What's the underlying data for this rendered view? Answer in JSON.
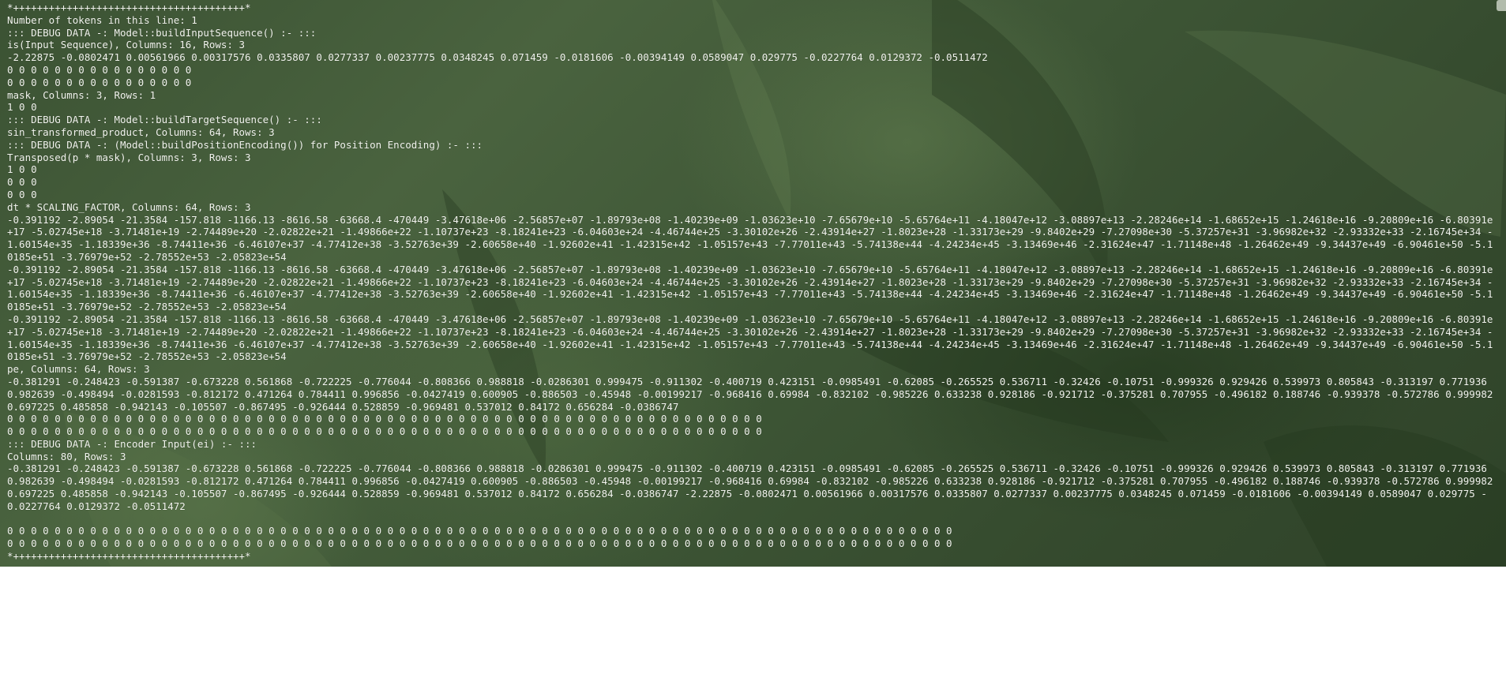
{
  "console": {
    "lines": [
      "*+++++++++++++++++++++++++++++++++++++++*",
      "Number of tokens in this line: 1",
      "::: DEBUG DATA -: Model::buildInputSequence() :- :::",
      "is(Input Sequence), Columns: 16, Rows: 3",
      "-2.22875 -0.0802471 0.00561966 0.00317576 0.0335807 0.0277337 0.00237775 0.0348245 0.071459 -0.0181606 -0.00394149 0.0589047 0.029775 -0.0227764 0.0129372 -0.0511472",
      "0 0 0 0 0 0 0 0 0 0 0 0 0 0 0 0",
      "0 0 0 0 0 0 0 0 0 0 0 0 0 0 0 0",
      "mask, Columns: 3, Rows: 1",
      "1 0 0",
      "::: DEBUG DATA -: Model::buildTargetSequence() :- :::",
      "sin_transformed_product, Columns: 64, Rows: 3",
      "::: DEBUG DATA -: (Model::buildPositionEncoding()) for Position Encoding) :- :::",
      "Transposed(p * mask), Columns: 3, Rows: 3",
      "1 0 0",
      "0 0 0",
      "0 0 0",
      "dt * SCALING_FACTOR, Columns: 64, Rows: 3",
      "-0.391192 -2.89054 -21.3584 -157.818 -1166.13 -8616.58 -63668.4 -470449 -3.47618e+06 -2.56857e+07 -1.89793e+08 -1.40239e+09 -1.03623e+10 -7.65679e+10 -5.65764e+11 -4.18047e+12 -3.08897e+13 -2.28246e+14 -1.68652e+15 -1.24618e+16 -9.20809e+16 -6.80391e+17 -5.02745e+18 -3.71481e+19 -2.74489e+20 -2.02822e+21 -1.49866e+22 -1.10737e+23 -8.18241e+23 -6.04603e+24 -4.46744e+25 -3.30102e+26 -2.43914e+27 -1.8023e+28 -1.33173e+29 -9.8402e+29 -7.27098e+30 -5.37257e+31 -3.96982e+32 -2.93332e+33 -2.16745e+34 -1.60154e+35 -1.18339e+36 -8.74411e+36 -6.46107e+37 -4.77412e+38 -3.52763e+39 -2.60658e+40 -1.92602e+41 -1.42315e+42 -1.05157e+43 -7.77011e+43 -5.74138e+44 -4.24234e+45 -3.13469e+46 -2.31624e+47 -1.71148e+48 -1.26462e+49 -9.34437e+49 -6.90461e+50 -5.10185e+51 -3.76979e+52 -2.78552e+53 -2.05823e+54",
      "-0.391192 -2.89054 -21.3584 -157.818 -1166.13 -8616.58 -63668.4 -470449 -3.47618e+06 -2.56857e+07 -1.89793e+08 -1.40239e+09 -1.03623e+10 -7.65679e+10 -5.65764e+11 -4.18047e+12 -3.08897e+13 -2.28246e+14 -1.68652e+15 -1.24618e+16 -9.20809e+16 -6.80391e+17 -5.02745e+18 -3.71481e+19 -2.74489e+20 -2.02822e+21 -1.49866e+22 -1.10737e+23 -8.18241e+23 -6.04603e+24 -4.46744e+25 -3.30102e+26 -2.43914e+27 -1.8023e+28 -1.33173e+29 -9.8402e+29 -7.27098e+30 -5.37257e+31 -3.96982e+32 -2.93332e+33 -2.16745e+34 -1.60154e+35 -1.18339e+36 -8.74411e+36 -6.46107e+37 -4.77412e+38 -3.52763e+39 -2.60658e+40 -1.92602e+41 -1.42315e+42 -1.05157e+43 -7.77011e+43 -5.74138e+44 -4.24234e+45 -3.13469e+46 -2.31624e+47 -1.71148e+48 -1.26462e+49 -9.34437e+49 -6.90461e+50 -5.10185e+51 -3.76979e+52 -2.78552e+53 -2.05823e+54",
      "-0.391192 -2.89054 -21.3584 -157.818 -1166.13 -8616.58 -63668.4 -470449 -3.47618e+06 -2.56857e+07 -1.89793e+08 -1.40239e+09 -1.03623e+10 -7.65679e+10 -5.65764e+11 -4.18047e+12 -3.08897e+13 -2.28246e+14 -1.68652e+15 -1.24618e+16 -9.20809e+16 -6.80391e+17 -5.02745e+18 -3.71481e+19 -2.74489e+20 -2.02822e+21 -1.49866e+22 -1.10737e+23 -8.18241e+23 -6.04603e+24 -4.46744e+25 -3.30102e+26 -2.43914e+27 -1.8023e+28 -1.33173e+29 -9.8402e+29 -7.27098e+30 -5.37257e+31 -3.96982e+32 -2.93332e+33 -2.16745e+34 -1.60154e+35 -1.18339e+36 -8.74411e+36 -6.46107e+37 -4.77412e+38 -3.52763e+39 -2.60658e+40 -1.92602e+41 -1.42315e+42 -1.05157e+43 -7.77011e+43 -5.74138e+44 -4.24234e+45 -3.13469e+46 -2.31624e+47 -1.71148e+48 -1.26462e+49 -9.34437e+49 -6.90461e+50 -5.10185e+51 -3.76979e+52 -2.78552e+53 -2.05823e+54",
      "pe, Columns: 64, Rows: 3",
      "-0.381291 -0.248423 -0.591387 -0.673228 0.561868 -0.722225 -0.776044 -0.808366 0.988818 -0.0286301 0.999475 -0.911302 -0.400719 0.423151 -0.0985491 -0.62085 -0.265525 0.536711 -0.32426 -0.10751 -0.999326 0.929426 0.539973 0.805843 -0.313197 0.771936 0.982639 -0.498494 -0.0281593 -0.812172 0.471264 0.784411 0.996856 -0.0427419 0.600905 -0.886503 -0.45948 -0.00199217 -0.968416 0.69984 -0.832102 -0.985226 0.633238 0.928186 -0.921712 -0.375281 0.707955 -0.496182 0.188746 -0.939378 -0.572786 0.999982 0.697225 0.485858 -0.942143 -0.105507 -0.867495 -0.926444 0.528859 -0.969481 0.537012 0.84172 0.656284 -0.0386747",
      "0 0 0 0 0 0 0 0 0 0 0 0 0 0 0 0 0 0 0 0 0 0 0 0 0 0 0 0 0 0 0 0 0 0 0 0 0 0 0 0 0 0 0 0 0 0 0 0 0 0 0 0 0 0 0 0 0 0 0 0 0 0 0 0",
      "0 0 0 0 0 0 0 0 0 0 0 0 0 0 0 0 0 0 0 0 0 0 0 0 0 0 0 0 0 0 0 0 0 0 0 0 0 0 0 0 0 0 0 0 0 0 0 0 0 0 0 0 0 0 0 0 0 0 0 0 0 0 0 0",
      "::: DEBUG DATA -: Encoder Input(ei) :- :::",
      "Columns: 80, Rows: 3",
      "-0.381291 -0.248423 -0.591387 -0.673228 0.561868 -0.722225 -0.776044 -0.808366 0.988818 -0.0286301 0.999475 -0.911302 -0.400719 0.423151 -0.0985491 -0.62085 -0.265525 0.536711 -0.32426 -0.10751 -0.999326 0.929426 0.539973 0.805843 -0.313197 0.771936 0.982639 -0.498494 -0.0281593 -0.812172 0.471264 0.784411 0.996856 -0.0427419 0.600905 -0.886503 -0.45948 -0.00199217 -0.968416 0.69984 -0.832102 -0.985226 0.633238 0.928186 -0.921712 -0.375281 0.707955 -0.496182 0.188746 -0.939378 -0.572786 0.999982 0.697225 0.485858 -0.942143 -0.105507 -0.867495 -0.926444 0.528859 -0.969481 0.537012 0.84172 0.656284 -0.0386747 -2.22875 -0.0802471 0.00561966 0.00317576 0.0335807 0.0277337 0.00237775 0.0348245 0.071459 -0.0181606 -0.00394149 0.0589047 0.029775 -0.0227764 0.0129372 -0.0511472",
      "",
      "0 0 0 0 0 0 0 0 0 0 0 0 0 0 0 0 0 0 0 0 0 0 0 0 0 0 0 0 0 0 0 0 0 0 0 0 0 0 0 0 0 0 0 0 0 0 0 0 0 0 0 0 0 0 0 0 0 0 0 0 0 0 0 0 0 0 0 0 0 0 0 0 0 0 0 0 0 0 0 0",
      "0 0 0 0 0 0 0 0 0 0 0 0 0 0 0 0 0 0 0 0 0 0 0 0 0 0 0 0 0 0 0 0 0 0 0 0 0 0 0 0 0 0 0 0 0 0 0 0 0 0 0 0 0 0 0 0 0 0 0 0 0 0 0 0 0 0 0 0 0 0 0 0 0 0 0 0 0 0 0 0",
      "*+++++++++++++++++++++++++++++++++++++++*"
    ]
  },
  "theme": {
    "text_color": "#f2f4ee",
    "background_color": "#3d5535",
    "page_color": "#ffffff"
  }
}
